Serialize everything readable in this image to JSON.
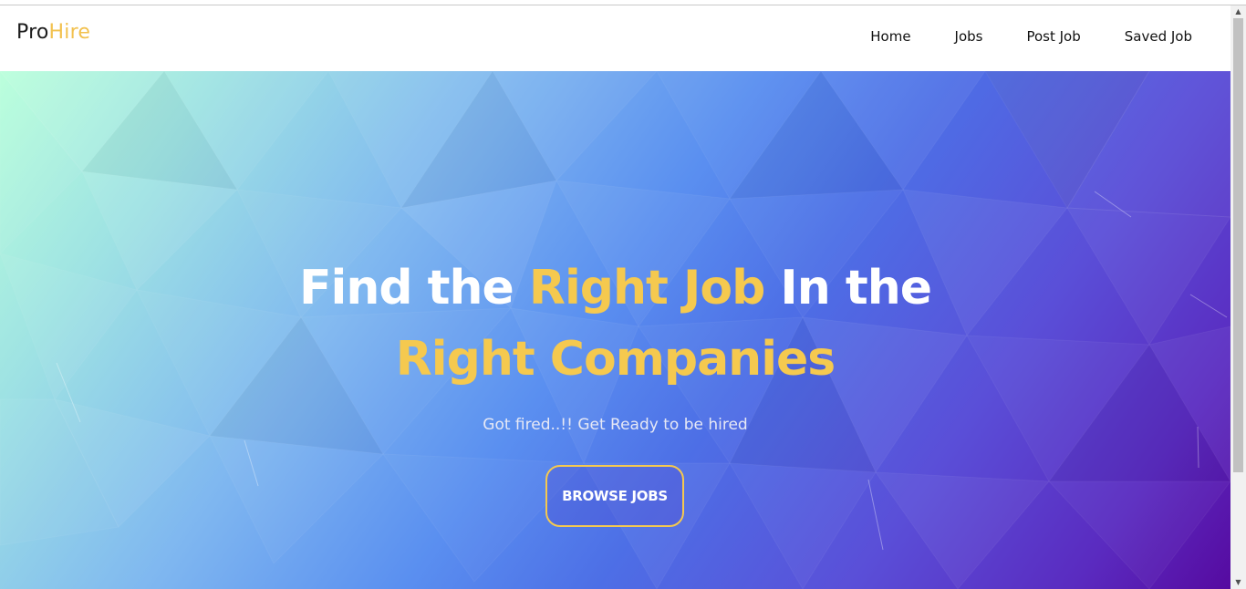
{
  "brand": {
    "part1": "Pro",
    "part2": "Hire"
  },
  "nav": {
    "items": [
      {
        "label": "Home"
      },
      {
        "label": "Jobs"
      },
      {
        "label": "Post Job"
      },
      {
        "label": "Saved Job"
      }
    ]
  },
  "hero": {
    "line1_a": "Find the ",
    "line1_b": "Right Job",
    "line1_c": " In the",
    "line2": "Right Companies",
    "subtitle": "Got fired..!! Get Ready to be hired",
    "button_label": "BROWSE JOBS"
  },
  "colors": {
    "accent": "#f5c94f",
    "nav_text": "#111111",
    "hero_text": "#ffffff"
  },
  "icons": {
    "scroll_up": "triangle-up-icon",
    "scroll_down": "triangle-down-icon"
  }
}
